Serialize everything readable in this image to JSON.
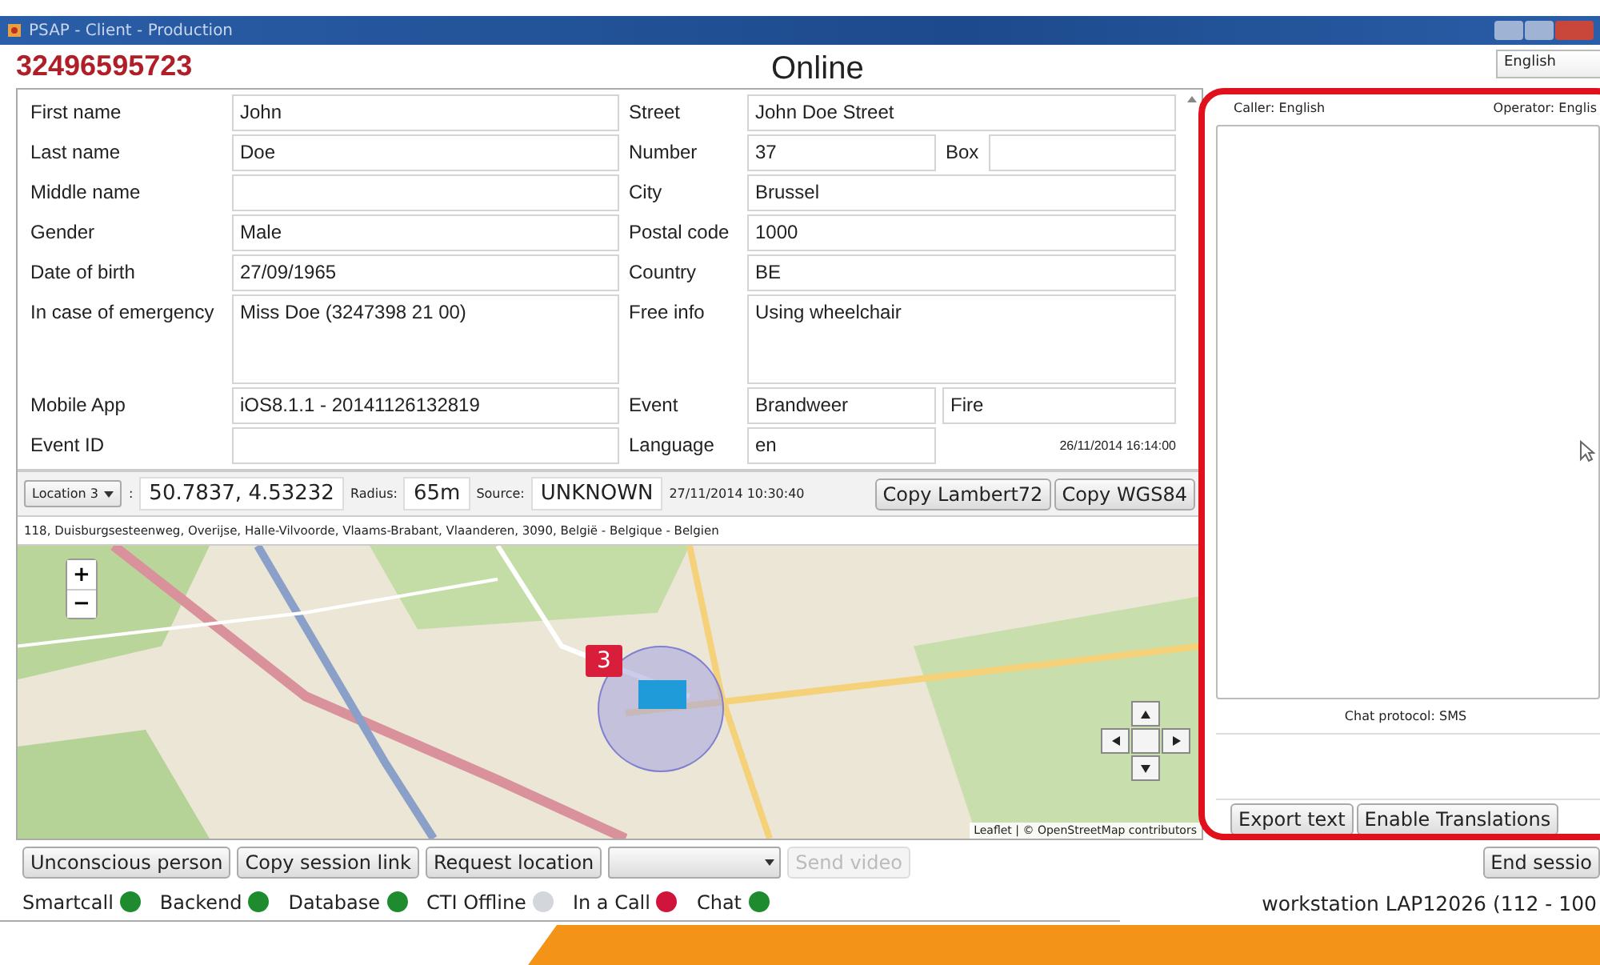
{
  "window": {
    "title": "PSAP - Client - Production"
  },
  "header": {
    "phone": "32496595723",
    "status": "Online",
    "language_select": "English"
  },
  "form": {
    "rows": [
      {
        "kind": "normal",
        "left": {
          "label": "First name",
          "value": "John"
        },
        "right": {
          "label": "Street",
          "value": "John Doe Street"
        }
      },
      {
        "kind": "normal",
        "left": {
          "label": "Last name",
          "value": "Doe"
        },
        "right": {
          "label": "Number",
          "value": "37",
          "extra_label": "Box"
        }
      },
      {
        "kind": "normal",
        "left": {
          "label": "Middle name"
        },
        "right": {
          "label": "City",
          "value": "Brussel"
        }
      },
      {
        "kind": "normal",
        "left": {
          "label": "Gender",
          "value": "Male"
        },
        "right": {
          "label": "Postal code",
          "value": "1000"
        }
      },
      {
        "kind": "normal",
        "left": {
          "label": "Date of birth",
          "value": "27/09/1965"
        },
        "right": {
          "label": "Country",
          "value": "BE"
        }
      },
      {
        "kind": "tall",
        "left": {
          "label": "In case of emergency",
          "value": "Miss Doe (3247398 21 00)"
        },
        "right": {
          "label": "Free info",
          "value": "Using wheelchair"
        }
      },
      {
        "kind": "normal",
        "left": {
          "label": "Mobile App",
          "value": "iOS8.1.1 - 20141126132819"
        },
        "right": {
          "label": "Event",
          "value": "Brandweer",
          "extra_value": "Fire"
        }
      },
      {
        "kind": "normal",
        "left": {
          "label": "Event ID"
        },
        "right": {
          "label": "Language",
          "value": "en",
          "timestamp": "26/11/2014 16:14:00"
        }
      }
    ]
  },
  "location": {
    "selector": "Location 3",
    "separator": ":",
    "coordinates": "50.7837, 4.53232",
    "radius_label": "Radius:",
    "radius": "65m",
    "source_label": "Source:",
    "source": "UNKNOWN",
    "timestamp": "27/11/2014 10:30:40",
    "buttons": [
      "Copy Lambert72",
      "Copy WGS84"
    ],
    "address": "118, Duisburgsesteenweg, Overijse, Halle-Vilvoorde, Vlaams-Brabant, Vlaanderen, 3090, België - Belgique - Belgien"
  },
  "map": {
    "zoom_in": "+",
    "zoom_out": "−",
    "marker_label": "3",
    "attribution": "Leaflet | © OpenStreetMap contributors"
  },
  "chat": {
    "caller": "Caller: English",
    "operator": "Operator: Englis",
    "protocol": "Chat protocol: SMS",
    "buttons": [
      "Export text",
      "Enable Translations"
    ]
  },
  "actions": [
    {
      "kind": "button",
      "label": "Unconscious person",
      "disabled": false
    },
    {
      "kind": "button",
      "label": "Copy session link",
      "disabled": false
    },
    {
      "kind": "button",
      "label": "Request location",
      "disabled": false
    },
    {
      "kind": "dropdown",
      "disabled": false
    },
    {
      "kind": "button",
      "label": "Send video",
      "disabled": true
    }
  ],
  "end_button": "End sessio",
  "statuses": [
    {
      "label": "Smartcall",
      "color": "#1e8c2e"
    },
    {
      "label": "Backend",
      "color": "#1e8c2e"
    },
    {
      "label": "Database",
      "color": "#1e8c2e"
    },
    {
      "label": "CTI Offline",
      "color": "#d3d6da"
    },
    {
      "label": "In a Call",
      "color": "#d0143c"
    },
    {
      "label": "Chat",
      "color": "#1e8c2e"
    }
  ],
  "footer": {
    "workstation": "workstation LAP12026 (112 - 100"
  }
}
